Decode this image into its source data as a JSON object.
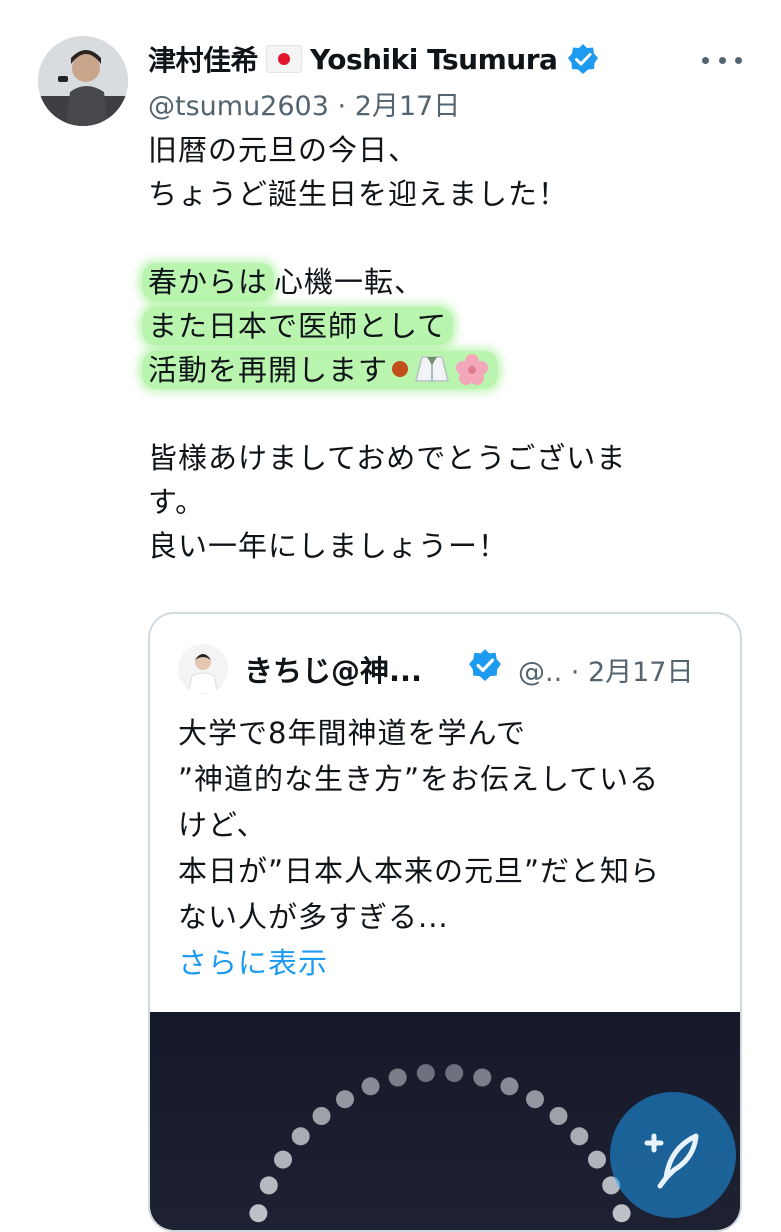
{
  "tweet": {
    "author_name": "津村佳希",
    "author_name_en": "Yoshiki Tsumura",
    "handle": "@tsumu2603",
    "separator": "·",
    "date": "2月17日",
    "lines": {
      "l1": "旧暦の元旦の今日、",
      "l2": "ちょうど誕生日を迎えました！",
      "l3_hl": "春からは",
      "l3_rest": "心機一転、",
      "l4": "また日本で医師として",
      "l5": "活動を再開します",
      "l6": "皆様あけましておめでとうございま",
      "l7": "す。",
      "l8": "良い一年にしましょうー！"
    }
  },
  "quoted": {
    "author_name": "きちじ@神...",
    "handle": "@..",
    "separator": "·",
    "date": "2月17日",
    "lines": {
      "l1": "大学で8年間神道を学んで",
      "l2": "”神道的な生き方”をお伝えしている",
      "l3": "けど、",
      "l4": "本日が”日本人本来の元旦”だと知ら",
      "l5": "ない人が多すぎる..."
    },
    "show_more": "さらに表示"
  },
  "icons": {
    "verified": "verified-badge-icon",
    "more": "more-icon",
    "compose": "compose-tweet-icon"
  },
  "colors": {
    "accent": "#1d9bf0",
    "highlight": "#82ec6e",
    "secondary_text": "#536471"
  }
}
